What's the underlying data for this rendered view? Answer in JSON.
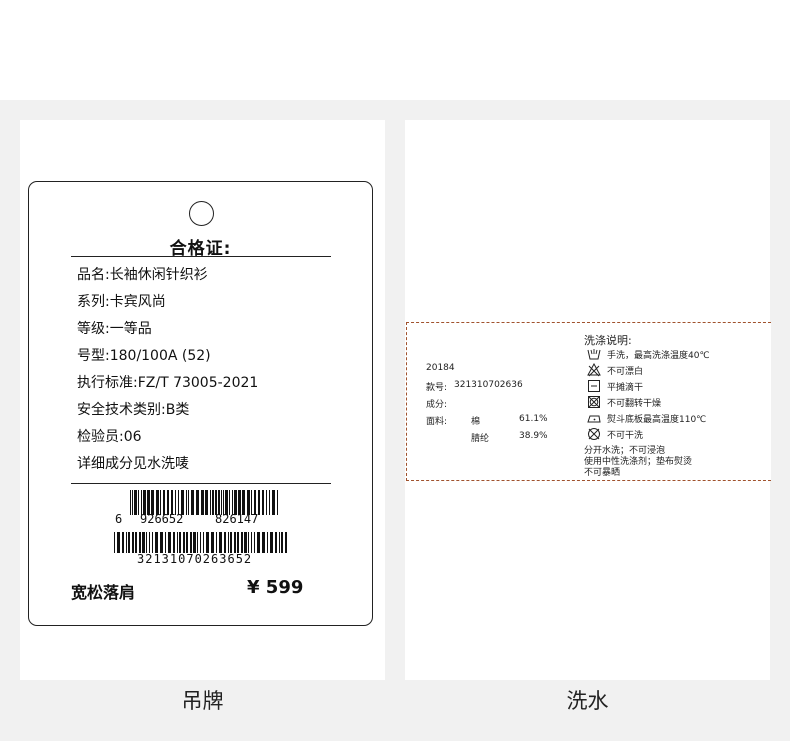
{
  "hang_tag": {
    "caption": "吊牌",
    "title": "合格证:",
    "fields": [
      "品名:长袖休闲针织衫",
      "系列:卡宾风尚",
      "等级:一等品",
      "号型:180/100A (52)",
      "执行标准:FZ/T 73005-2021",
      "安全技术类别:B类",
      "检验员:06",
      "详细成分见水洗唛"
    ],
    "barcode_1": {
      "lead": "6",
      "group1": "926652",
      "group2": "826147"
    },
    "barcode_2": {
      "number": "32131070263652"
    },
    "style_name": "宽松落肩",
    "price": "¥ 599"
  },
  "wash_label": {
    "caption": "洗水",
    "code": "20184",
    "item_no_label": "款号:",
    "item_no": "321310702636",
    "composition_label": "成分:",
    "fabric_label": "面料:",
    "materials": [
      {
        "name": "棉",
        "percent": "61.1%"
      },
      {
        "name": "腈纶",
        "percent": "38.9%"
      }
    ],
    "care_title": "洗涤说明:",
    "care_items": [
      {
        "icon": "hand-wash-icon",
        "text": "手洗，最高洗涤温度40℃"
      },
      {
        "icon": "no-bleach-icon",
        "text": "不可漂白"
      },
      {
        "icon": "flat-dry-icon",
        "text": "平摊滴干"
      },
      {
        "icon": "no-tumble-dry-icon",
        "text": "不可翻转干燥"
      },
      {
        "icon": "iron-icon",
        "text": "熨斗底板最高温度110℃"
      },
      {
        "icon": "no-dry-clean-icon",
        "text": "不可干洗"
      }
    ],
    "notes": [
      "分开水洗；不可浸泡",
      "使用中性洗涤剂；垫布熨烫",
      "不可暴晒"
    ]
  },
  "colors": {
    "label_border": "#a0522d",
    "band": "#f1f1f1"
  }
}
